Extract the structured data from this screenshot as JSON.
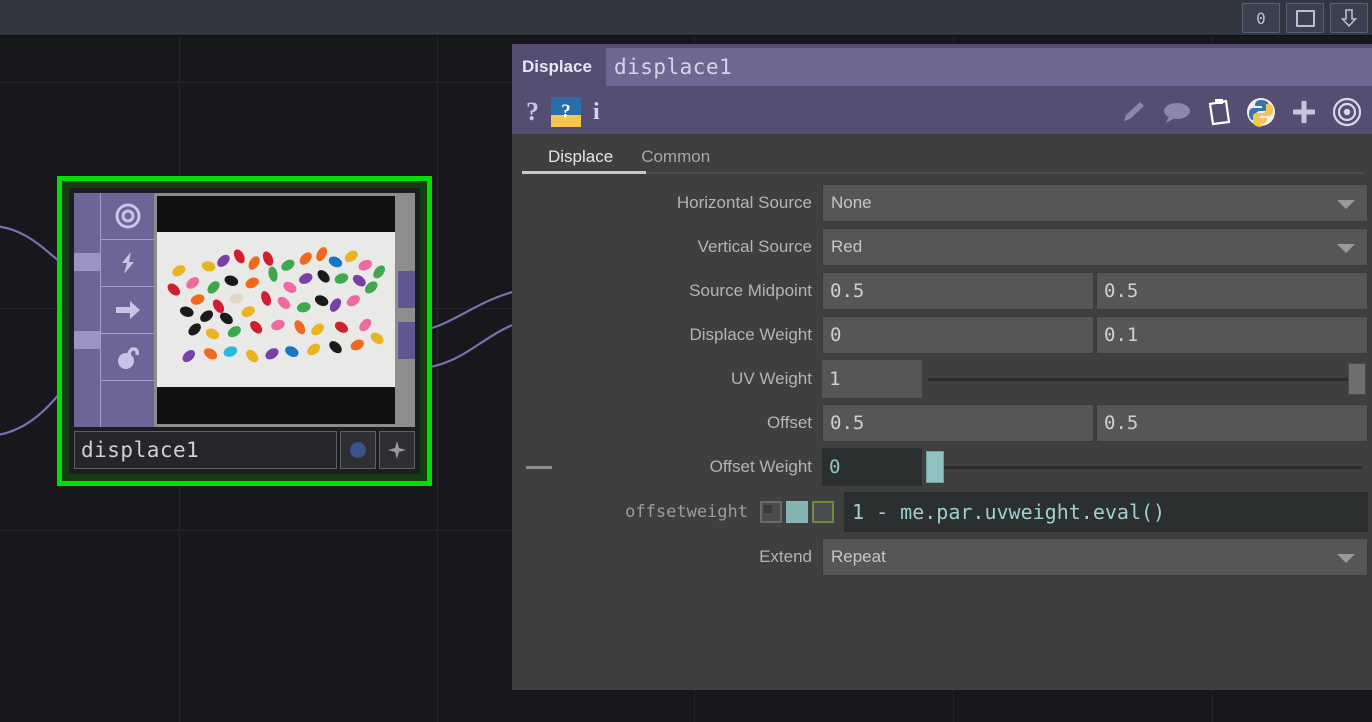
{
  "topbar": {
    "counter": "0",
    "maximize_icon": "window-square-icon",
    "download_icon": "arrow-down-icon"
  },
  "network": {
    "node": {
      "name": "displace1",
      "selected": true,
      "flags": [
        "viewer-icon",
        "bypass-icon",
        "render-icon",
        "clone-icon"
      ],
      "viewer_button_icon": "blue-dot-icon",
      "extra_button_icon": "star-icon",
      "thumbnail_alt": "colored jelly beans on white background"
    }
  },
  "parameters": {
    "op_type": "Displace",
    "op_name": "displace1",
    "toolbar": {
      "help_label": "?",
      "wiki_label": "?",
      "info_label": "i",
      "icons": [
        "pencil-icon",
        "comment-icon",
        "clipboard-icon",
        "python-icon",
        "plus-icon",
        "target-icon"
      ]
    },
    "tabs": [
      {
        "label": "Displace",
        "active": true
      },
      {
        "label": "Common",
        "active": false
      }
    ],
    "rows": [
      {
        "label": "Horizontal Source",
        "type": "menu",
        "value": "None"
      },
      {
        "label": "Vertical Source",
        "type": "menu",
        "value": "Red"
      },
      {
        "label": "Source Midpoint",
        "type": "pair",
        "value1": "0.5",
        "value2": "0.5"
      },
      {
        "label": "Displace Weight",
        "type": "pair",
        "value1": "0",
        "value2": "0.1"
      },
      {
        "label": "UV Weight",
        "type": "slider",
        "value": "1",
        "handle_pct": 100,
        "expression": false
      },
      {
        "label": "Offset",
        "type": "pair",
        "value1": "0.5",
        "value2": "0.5"
      },
      {
        "label": "Offset Weight",
        "type": "slider",
        "value": "0",
        "handle_pct": 0,
        "expression": true,
        "minus_toggle": true
      },
      {
        "label": "Extend",
        "type": "menu",
        "value": "Repeat"
      }
    ],
    "expression_row": {
      "par_name": "offsetweight",
      "mode_constant": "constant-mode-icon",
      "mode_expression": "expression-mode-icon",
      "mode_export": "export-mode-icon",
      "expression": "1 - me.par.uvweight.eval()"
    }
  },
  "colors": {
    "selection_green": "#00e000",
    "node_purple": "#6d6597",
    "panel_header_purple": "#564e72",
    "expression_teal": "#8fc4c4",
    "panel_bg": "#3f3f3f"
  }
}
